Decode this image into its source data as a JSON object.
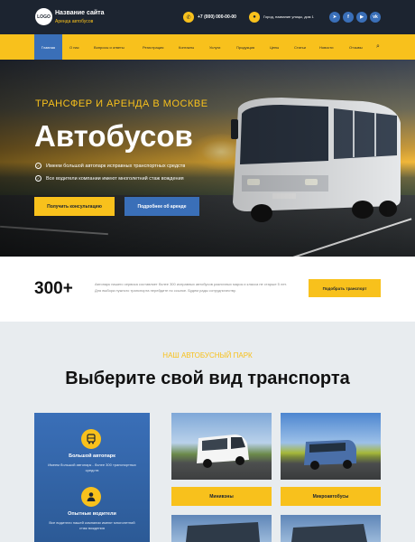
{
  "header": {
    "logo_text": "LOGO",
    "site_name": "Название сайта",
    "site_tagline": "Аренда автобусов",
    "phone": "+7 (000) 000-00-00",
    "address": "Город, название улицы, дом 1",
    "social": [
      {
        "icon": "telegram-icon",
        "glyph": "➤"
      },
      {
        "icon": "facebook-icon",
        "glyph": "f"
      },
      {
        "icon": "youtube-icon",
        "glyph": "▶"
      },
      {
        "icon": "vk-icon",
        "glyph": "vk"
      }
    ]
  },
  "nav": {
    "items": [
      "Главная",
      "О нас",
      "Вопросы и ответы",
      "Регистрация",
      "Контакты",
      "Услуги",
      "Продукция",
      "Цены",
      "Статьи",
      "Новости",
      "Отзывы"
    ],
    "active_index": 0,
    "search_glyph": "⌕"
  },
  "hero": {
    "subtitle": "ТРАНСФЕР И АРЕНДА В МОСКВЕ",
    "title": "Автобусов",
    "bullets": [
      "Имеем большой автопарк исправных транспортных средств",
      "Все водители компании имеют многолетний стаж вождения"
    ],
    "cta_primary": "Получить консультацию",
    "cta_secondary": "Подробнее об аренде"
  },
  "stats": {
    "number": "300+",
    "text": "Автопарк нашего сервиса составляет более 300 исправных автобусов различных марок и класса не старше 5 лет. Для выбора нужного транспорта перейдите по ссылке. Будем рады сотрудничеству.",
    "button": "Подобрать транспорт"
  },
  "fleet": {
    "kicker": "НАШ АВТОБУСНЫЙ ПАРК",
    "title": "Выберите свой вид транспорта",
    "features": [
      {
        "icon": "bus-icon",
        "title": "Большой автопарк",
        "text": "Имеем большой автопарк - более 300 транспортных средств"
      },
      {
        "icon": "driver-icon",
        "title": "Опытные водители",
        "text": "Все водители нашей компании имеют многолетний стаж вождения"
      }
    ],
    "vehicles": [
      "Минивэны",
      "Микроавтобусы"
    ]
  },
  "colors": {
    "accent_yellow": "#f8c11c",
    "accent_blue": "#3a6fb8",
    "dark": "#1c2430"
  }
}
